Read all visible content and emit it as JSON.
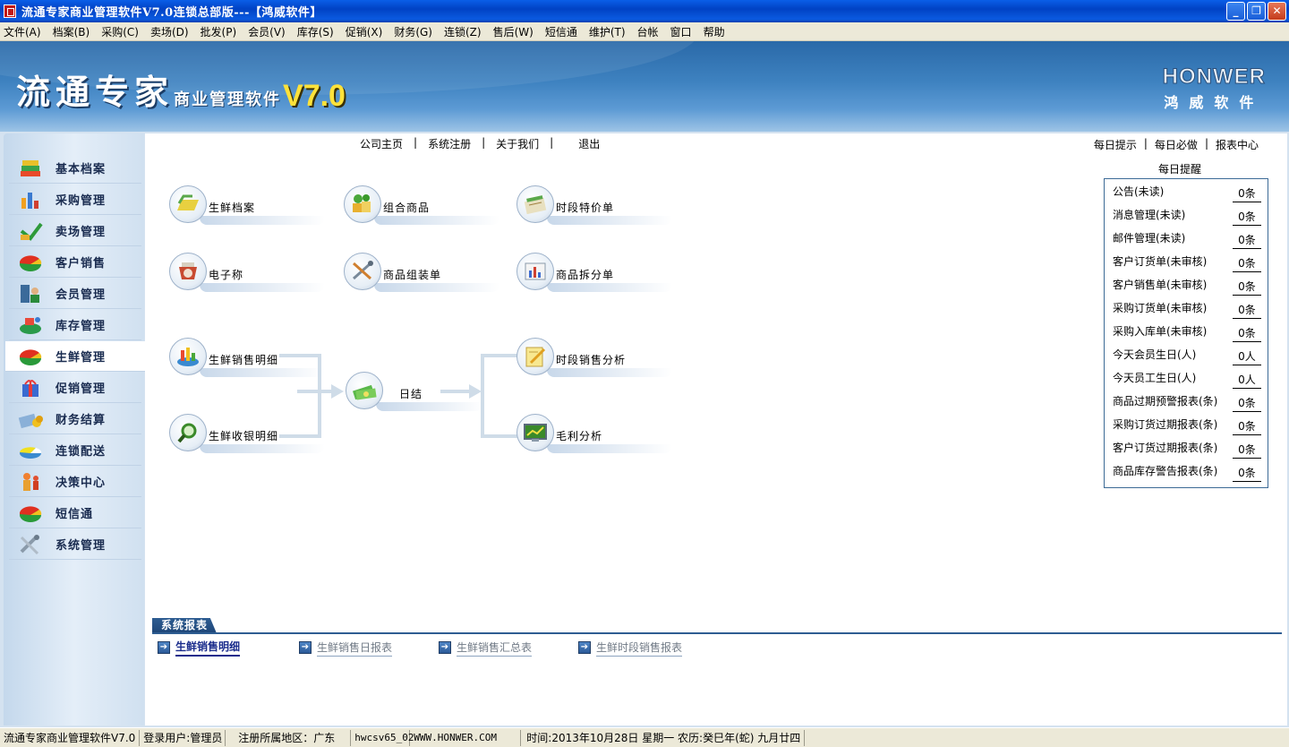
{
  "window": {
    "title": "流通专家商业管理软件V7.0连锁总部版---【鸿威软件】",
    "minimize": "_",
    "restore": "❐",
    "close": "✕"
  },
  "menu": [
    "文件(A)",
    "档案(B)",
    "采购(C)",
    "卖场(D)",
    "批发(P)",
    "会员(V)",
    "库存(S)",
    "促销(X)",
    "财务(G)",
    "连锁(Z)",
    "售后(W)",
    "短信通",
    "维护(T)",
    "台帐",
    "窗口",
    "帮助"
  ],
  "banner": {
    "brand_big": "流通专家",
    "brand_mid": "商业管理软件",
    "brand_ver": "V7.0",
    "company_en": "HONWER",
    "company_cn": "鸿威软件"
  },
  "sidebar": [
    {
      "label": "基本档案",
      "icon": "books-icon"
    },
    {
      "label": "采购管理",
      "icon": "purchase-icon"
    },
    {
      "label": "卖场管理",
      "icon": "store-icon"
    },
    {
      "label": "客户销售",
      "icon": "pie-chart-icon"
    },
    {
      "label": "会员管理",
      "icon": "members-icon"
    },
    {
      "label": "库存管理",
      "icon": "inventory-icon"
    },
    {
      "label": "生鲜管理",
      "icon": "pie-chart-icon"
    },
    {
      "label": "促销管理",
      "icon": "gift-icon"
    },
    {
      "label": "财务结算",
      "icon": "calculator-icon"
    },
    {
      "label": "连锁配送",
      "icon": "delivery-icon"
    },
    {
      "label": "决策中心",
      "icon": "decision-icon"
    },
    {
      "label": "短信通",
      "icon": "pie-chart-icon"
    },
    {
      "label": "系统管理",
      "icon": "tools-icon"
    }
  ],
  "sidebar_active": "生鲜管理",
  "top_links": [
    "公司主页",
    "系统注册",
    "关于我们",
    "退出"
  ],
  "top_sep": "|",
  "right_links": [
    "每日提示",
    "每日必做",
    "报表中心"
  ],
  "tiles": {
    "fresh_archive": "生鲜档案",
    "combo_goods": "组合商品",
    "period_special": "时段特价单",
    "e_scale": "电子称",
    "assembly": "商品组装单",
    "split": "商品拆分单",
    "fresh_sales_detail": "生鲜销售明细",
    "fresh_cashier_detail": "生鲜收银明细",
    "daily_close": "日结",
    "period_sales_analysis": "时段销售分析",
    "gross_profit": "毛利分析"
  },
  "reminder": {
    "title": "每日提醒",
    "rows": [
      {
        "label": "公告(未读)",
        "value": "0条"
      },
      {
        "label": "消息管理(未读)",
        "value": "0条"
      },
      {
        "label": "邮件管理(未读)",
        "value": "0条"
      },
      {
        "label": "客户订货单(未审核)",
        "value": "0条"
      },
      {
        "label": "客户销售单(未审核)",
        "value": "0条"
      },
      {
        "label": "采购订货单(未审核)",
        "value": "0条"
      },
      {
        "label": "采购入库单(未审核)",
        "value": "0条"
      },
      {
        "label": "今天会员生日(人)",
        "value": "0人"
      },
      {
        "label": "今天员工生日(人)",
        "value": "0人"
      },
      {
        "label": "商品过期预警报表(条)",
        "value": "0条"
      },
      {
        "label": "采购订货过期报表(条)",
        "value": "0条"
      },
      {
        "label": "客户订货过期报表(条)",
        "value": "0条"
      },
      {
        "label": "商品库存警告报表(条)",
        "value": "0条"
      }
    ]
  },
  "reports": {
    "tab": "系统报表",
    "items": [
      "生鲜销售明细",
      "生鲜销售日报表",
      "生鲜销售汇总表",
      "生鲜时段销售报表"
    ]
  },
  "status": {
    "app": "流通专家商业管理软件V7.0",
    "user": "登录用户:管理员",
    "region": "注册所属地区：广东",
    "code": "hwcsv65_02",
    "site": "WWW.HONWER.COM",
    "datetime": "时间:2013年10月28日   星期一   农历:癸巳年(蛇) 九月廿四"
  },
  "colors": {
    "titlebar": "#0142c4",
    "banner": "#3e82c0",
    "accent_yellow": "#ffe23a",
    "sidebar": "#d4e2f0",
    "report_blue": "#2e5d92"
  }
}
